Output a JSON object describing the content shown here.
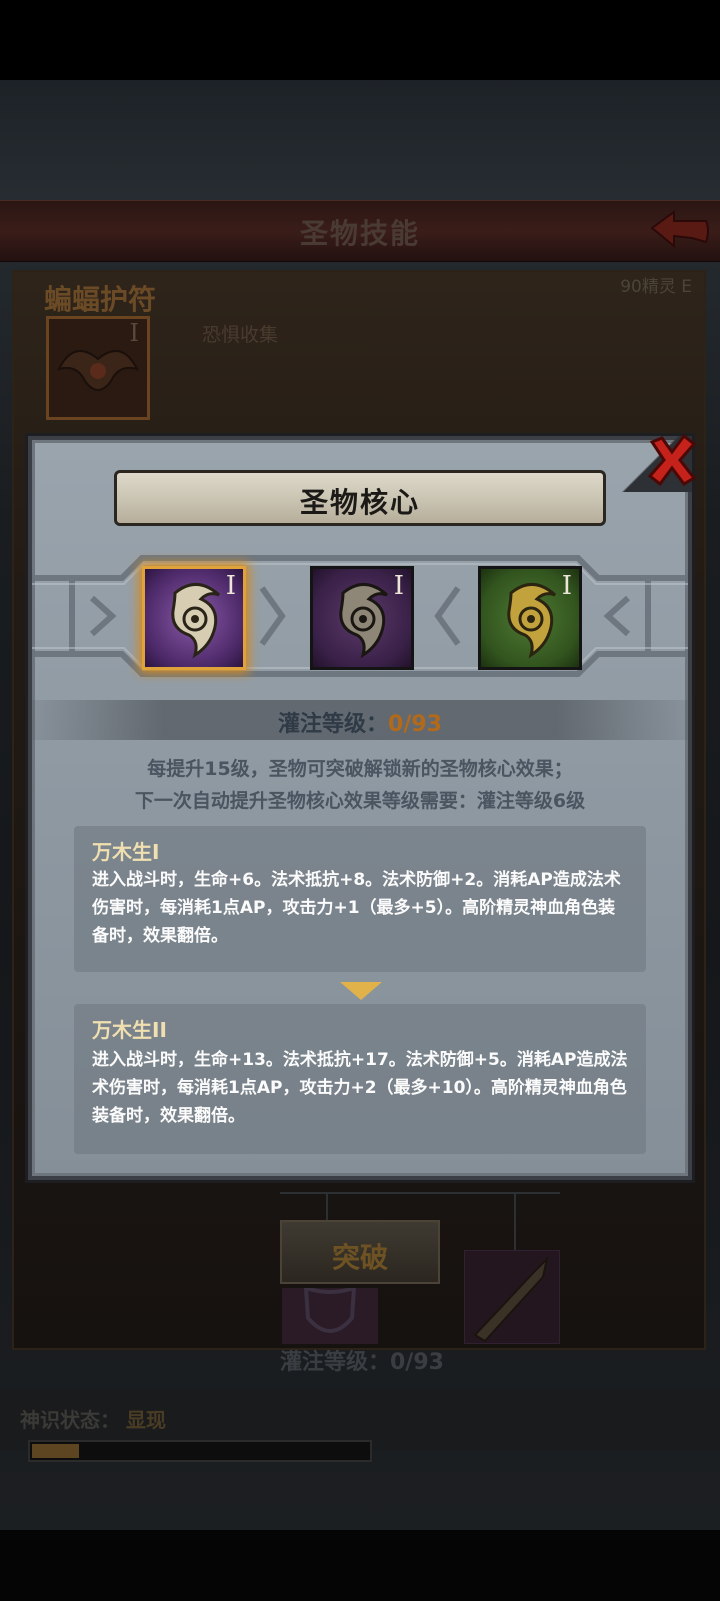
{
  "screen": {
    "title": "圣物技能",
    "relic_name": "蝙蝠护符",
    "relic_level": "90精灵 E",
    "relic_subtitle": "恐惧收集",
    "relic_roman": "I",
    "button_label": "突破",
    "infuse_text": "灌注等级：0/93",
    "status_label": "神识状态：",
    "status_value": "显现",
    "status_progress": 0.14
  },
  "modal": {
    "title": "圣物核心",
    "cores": [
      {
        "roman": "I",
        "color": "purple",
        "selected": true
      },
      {
        "roman": "I",
        "color": "dark-purple",
        "selected": false
      },
      {
        "roman": "I",
        "color": "green",
        "selected": false
      }
    ],
    "infuse": {
      "label": "灌注等级：",
      "value": "0/93"
    },
    "desc_line1": "每提升15级，圣物可突破解锁新的圣物核心效果；",
    "desc_line2": "下一次自动提升圣物核心效果等级需要：灌注等级6级",
    "effects": [
      {
        "name": "万木生I",
        "body": "进入战斗时，生命+6。法术抵抗+8。法术防御+2。消耗AP造成法术伤害时，每消耗1点AP，攻击力+1（最多+5）。高阶精灵神血角色装备时，效果翻倍。"
      },
      {
        "name": "万木生II",
        "body": "进入战斗时，生命+13。法术抵抗+17。法术防御+5。消耗AP造成法术伤害时，每消耗1点AP，攻击力+2（最多+10）。高阶精灵神血角色装备时，效果翻倍。"
      }
    ]
  },
  "colors": {
    "accent_orange": "#b26a1a",
    "selected_border": "#e0a33a",
    "close_red": "#c4221a",
    "effect_title": "#f0dfb0"
  },
  "icons": [
    "back-arrow-icon",
    "close-icon",
    "relic-core-icon",
    "chevron-down-icon",
    "bat-amulet-icon",
    "spear-icon",
    "shield-icon"
  ]
}
